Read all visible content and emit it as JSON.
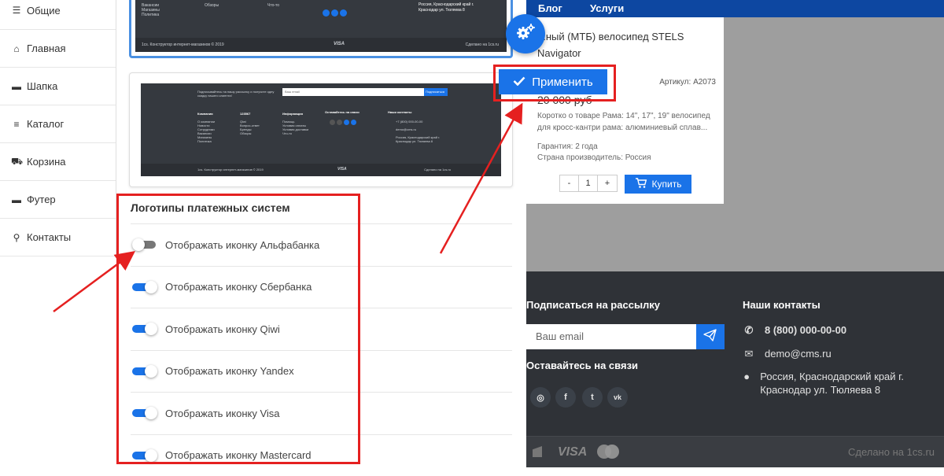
{
  "sidebar": {
    "items": [
      {
        "label": "Общие",
        "icon": "sliders-icon"
      },
      {
        "label": "Главная",
        "icon": "home-icon"
      },
      {
        "label": "Шапка",
        "icon": "window-header-icon"
      },
      {
        "label": "Каталог",
        "icon": "list-icon"
      },
      {
        "label": "Корзина",
        "icon": "cart-icon"
      },
      {
        "label": "Футер",
        "icon": "window-footer-icon"
      },
      {
        "label": "Контакты",
        "icon": "map-icon"
      }
    ]
  },
  "thumb1": {
    "links": [
      "Вакансии",
      "Магазины",
      "Политика"
    ],
    "link2": "Обзоры",
    "link3": "Что-то",
    "address": "Россия, Краснодарский край г. Краснодар ул. Тюляева 8",
    "copyright": "1cs. Конструктор интернет-магазинов © 2019",
    "made": "Сделано на 1cs.ru"
  },
  "thumb2": {
    "subscribe": "Подписывайтесь на нашу рассылку и получите одну скидку нашего клиента!",
    "email_placeholder": "Ваш email",
    "subscribe_btn": "Подписаться",
    "col1_title": "Компания",
    "col1": [
      "О компании",
      "Новости",
      "Сотрудники",
      "Вакансии",
      "Магазины",
      "Политика"
    ],
    "col2_title": "123567",
    "col2": [
      "Qiwi",
      "Вопрос-ответ",
      "Бренды",
      "Обзоры"
    ],
    "col3_title": "Информация",
    "col3": [
      "Помощь",
      "Условия оплаты",
      "Условия доставки",
      "Что-то"
    ],
    "col4_title": "Оставайтесь на связи",
    "col5_title": "Наши контакты",
    "phone": "+7 (800) 000-00-00",
    "email": "demo@cms.ru",
    "address": "Россия, Краснодарский край г. Краснодар ул. Тюляева 8",
    "copyright": "1cs. Конструктор интернет-магазинов © 2019",
    "made": "Сделано на 1cs.ru"
  },
  "payment_section": {
    "title": "Логотипы платежных систем",
    "toggles": [
      {
        "label": "Отображать иконку Альфабанка",
        "on": false
      },
      {
        "label": "Отображать иконку Сбербанка",
        "on": true
      },
      {
        "label": "Отображать иконку Qiwi",
        "on": true
      },
      {
        "label": "Отображать иконку Yandex",
        "on": true
      },
      {
        "label": "Отображать иконку Visa",
        "on": true
      },
      {
        "label": "Отображать иконку Mastercard",
        "on": true
      }
    ]
  },
  "apply_button": {
    "label": "Применить"
  },
  "preview": {
    "nav": [
      "Блог",
      "Услуги"
    ],
    "product": {
      "title": "...ный (МТБ) велосипед STELS Navigator",
      "article": "Артикул: A2073",
      "price": "20 000 руб",
      "desc": "Коротко о товаре Рама: 14\", 17\", 19\" велосипед для кросс-кантри рама: алюминиевый сплав...",
      "warranty": "Гарантия: 2 года",
      "country": "Страна производитель: Россия",
      "qty": "1",
      "buy": "Купить"
    },
    "footer": {
      "subscribe_title": "Подписаться на рассылку",
      "email_placeholder": "Ваш email",
      "stay_title": "Оставайтесь на связи",
      "contacts_title": "Наши контакты",
      "phone": "8 (800) 000-00-00",
      "email": "demo@cms.ru",
      "address": "Россия, Краснодарский край г. Краснодар ул. Тюляева 8",
      "visa": "VISA",
      "made": "Сделано на 1cs.ru"
    }
  },
  "colors": {
    "accent": "#1a73e8",
    "highlight": "#e52020",
    "footer_bg": "#2f3237"
  }
}
